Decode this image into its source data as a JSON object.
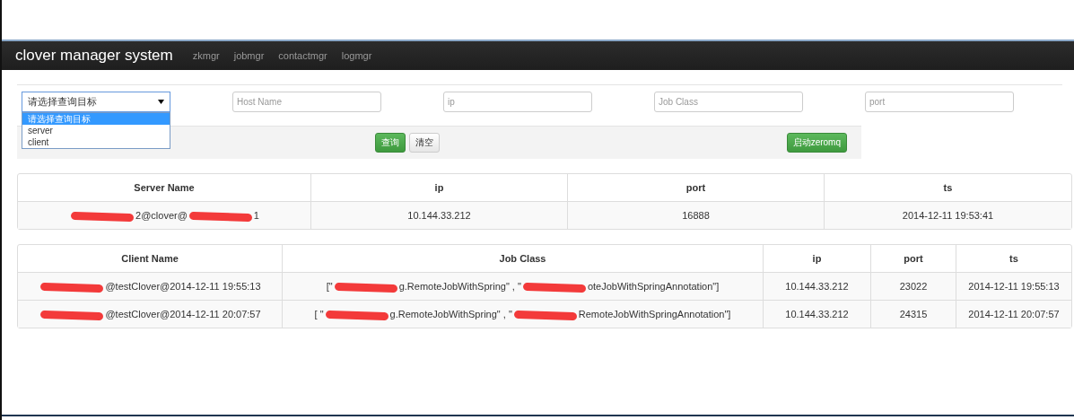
{
  "navbar": {
    "brand": "clover manager system",
    "links": [
      "zkmgr",
      "jobmgr",
      "contactmgr",
      "logmgr"
    ]
  },
  "filters": {
    "select": {
      "value": "请选择查询目标",
      "expanded": true,
      "options": [
        {
          "label": "请选择查询目标",
          "selected": true
        },
        {
          "label": "server",
          "selected": false
        },
        {
          "label": "client",
          "selected": false
        }
      ]
    },
    "fields": [
      {
        "placeholder": "Host Name"
      },
      {
        "placeholder": "ip"
      },
      {
        "placeholder": "Job Class"
      },
      {
        "placeholder": "port"
      }
    ]
  },
  "actions": [
    {
      "label": "查询",
      "kind": "success"
    },
    {
      "label": "清空",
      "kind": "default"
    },
    {
      "label": "启动zeromq",
      "kind": "success"
    }
  ],
  "server_table": {
    "columns": [
      "Server Name",
      "ip",
      "port",
      "ts"
    ],
    "rows": [
      [
        [
          {
            "kind": "redaction"
          },
          {
            "kind": "text",
            "text": "2@clover@"
          },
          {
            "kind": "redaction"
          },
          {
            "kind": "text",
            "text": "1"
          }
        ],
        [
          {
            "kind": "text",
            "text": "10.144.33.212"
          }
        ],
        [
          {
            "kind": "text",
            "text": "16888"
          }
        ],
        [
          {
            "kind": "text",
            "text": "2014-12-11 19:53:41"
          }
        ]
      ]
    ]
  },
  "client_table": {
    "columns": [
      "Client Name",
      "Job Class",
      "ip",
      "port",
      "ts"
    ],
    "rows": [
      [
        [
          {
            "kind": "redaction"
          },
          {
            "kind": "text",
            "text": "@testClover@2014-12-11 19:55:13"
          }
        ],
        [
          {
            "kind": "text",
            "text": "[\""
          },
          {
            "kind": "redaction"
          },
          {
            "kind": "text",
            "text": "g.RemoteJobWithSpring\" , \""
          },
          {
            "kind": "redaction"
          },
          {
            "kind": "text",
            "text": "oteJobWithSpringAnnotation\"]"
          }
        ],
        [
          {
            "kind": "text",
            "text": "10.144.33.212"
          }
        ],
        [
          {
            "kind": "text",
            "text": "23022"
          }
        ],
        [
          {
            "kind": "text",
            "text": "2014-12-11 19:55:13"
          }
        ]
      ],
      [
        [
          {
            "kind": "redaction"
          },
          {
            "kind": "text",
            "text": "@testClover@2014-12-11 20:07:57"
          }
        ],
        [
          {
            "kind": "text",
            "text": "[ \""
          },
          {
            "kind": "redaction"
          },
          {
            "kind": "text",
            "text": "g.RemoteJobWithSpring\" , \""
          },
          {
            "kind": "redaction"
          },
          {
            "kind": "text",
            "text": "RemoteJobWithSpringAnnotation\"]"
          }
        ],
        [
          {
            "kind": "text",
            "text": "10.144.33.212"
          }
        ],
        [
          {
            "kind": "text",
            "text": "24315"
          }
        ],
        [
          {
            "kind": "text",
            "text": "2014-12-11 20:07:57"
          }
        ]
      ]
    ]
  }
}
